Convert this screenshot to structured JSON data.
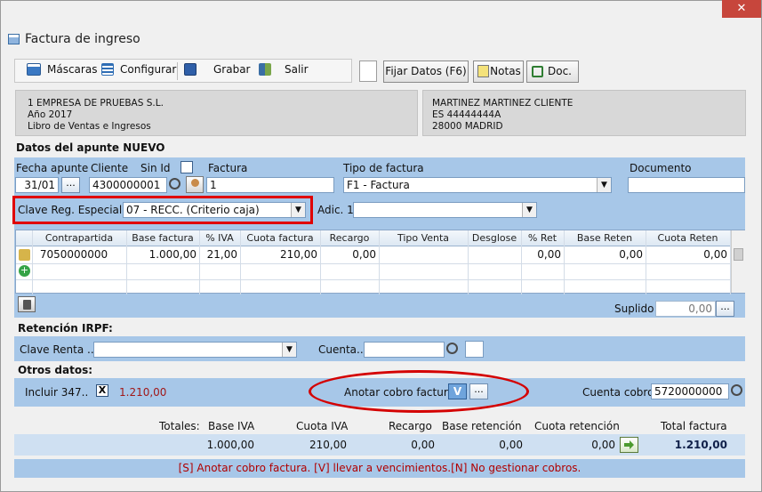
{
  "window": {
    "title": "Factura de ingreso",
    "close_glyph": "✕"
  },
  "toolbar": {
    "mascaras": "Máscaras",
    "configurar": "Configurar",
    "grabar": "Grabar",
    "salir": "Salir",
    "fijar_datos": "Fijar Datos (F6)",
    "notas": "Notas",
    "doc": "Doc."
  },
  "company": {
    "line1": "1 EMPRESA DE PRUEBAS S.L.",
    "line2": "Año 2017",
    "line3": "Libro de Ventas e Ingresos"
  },
  "client": {
    "line1": "MARTINEZ MARTINEZ CLIENTE",
    "line2": "ES 44444444A",
    "line3": "28000 MADRID"
  },
  "apunte": {
    "section_title": "Datos del apunte NUEVO",
    "fecha_label": "Fecha apunte",
    "fecha_value": "31/01",
    "cliente_label": "Cliente",
    "cliente_value": "4300000001",
    "sin_id_label": "Sin Id",
    "factura_label": "Factura",
    "factura_value": "1",
    "tipo_label": "Tipo de factura",
    "tipo_value": "F1 - Factura",
    "documento_label": "Documento",
    "documento_value": "",
    "clave_label": "Clave Reg. Especial...",
    "clave_value": "07 - RECC. (Criterio caja)",
    "adic_label": "Adic. 1",
    "adic_value": "",
    "ellipsis": "..."
  },
  "grid": {
    "columns": [
      "Contrapartida",
      "Base factura",
      "% IVA",
      "Cuota factura",
      "Recargo",
      "Tipo Venta",
      "Desglose",
      "% Ret",
      "Base Reten",
      "Cuota Reten"
    ],
    "rows": [
      [
        "7050000000",
        "1.000,00",
        "21,00",
        "210,00",
        "0,00",
        "",
        "",
        "0,00",
        "0,00",
        "0,00"
      ]
    ]
  },
  "suplido": {
    "label": "Suplido",
    "value": "0,00"
  },
  "retencion": {
    "section_title": "Retención IRPF:",
    "clave_label": "Clave Renta ...",
    "clave_value": "",
    "cuenta_label": "Cuenta...",
    "cuenta_value": ""
  },
  "otros": {
    "section_title": "Otros datos:",
    "incluir_label": "Incluir 347..",
    "incluir_check": "X",
    "incluir_amount": "1.210,00",
    "anotar_label": "Anotar cobro factura",
    "anotar_value": "V",
    "cuenta_cobro_label": "Cuenta cobro",
    "cuenta_cobro_value": "5720000000"
  },
  "totales": {
    "label": "Totales:",
    "base_iva_label": "Base IVA",
    "cuota_iva_label": "Cuota IVA",
    "recargo_label": "Recargo",
    "base_ret_label": "Base retención",
    "cuota_ret_label": "Cuota retención",
    "total_label": "Total factura",
    "base_iva": "1.000,00",
    "cuota_iva": "210,00",
    "recargo": "0,00",
    "base_ret": "0,00",
    "cuota_ret": "0,00",
    "total": "1.210,00"
  },
  "status": "[S] Anotar cobro factura. [V] llevar a vencimientos.[N] No gestionar cobros."
}
